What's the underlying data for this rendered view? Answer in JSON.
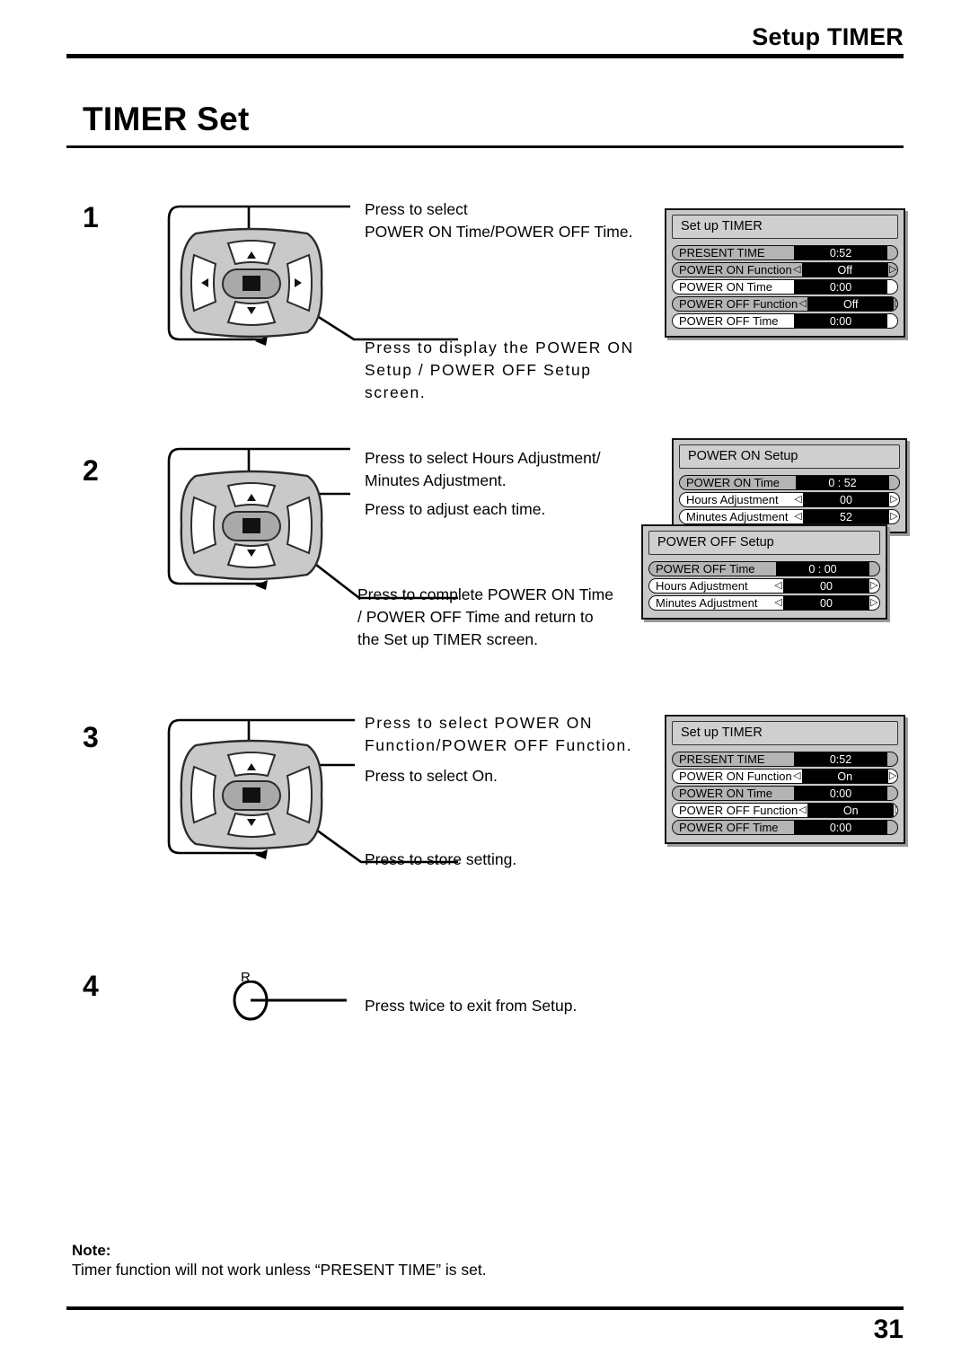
{
  "header": {
    "section_title": "Setup TIMER",
    "page_title": "TIMER Set",
    "page_number": "31"
  },
  "steps": [
    {
      "number": "1",
      "callouts": [
        "Press to select\nPOWER ON Time/POWER OFF Time.",
        "Press to display the POWER ON\nSetup / POWER OFF Setup\nscreen."
      ]
    },
    {
      "number": "2",
      "callouts": [
        "Press to select Hours Adjustment/\nMinutes Adjustment.",
        "Press to adjust each time.",
        "Press to complete POWER ON Time\n/ POWER OFF Time and return to\nthe Set up TIMER screen."
      ]
    },
    {
      "number": "3",
      "callouts": [
        "Press to select POWER ON\nFunction/POWER OFF Function.",
        "Press to select On.",
        "Press to store setting."
      ]
    },
    {
      "number": "4",
      "button_label": "R",
      "callouts": [
        "Press twice to exit from Setup."
      ]
    }
  ],
  "osd_panels": [
    {
      "id": "timer-1",
      "title": "Set up TIMER",
      "rows": [
        {
          "label": "PRESENT TIME",
          "value": "0:52",
          "fill": "grey",
          "arrows": false
        },
        {
          "label": "POWER ON Function",
          "value": "Off",
          "fill": "grey",
          "arrows": true
        },
        {
          "label": "POWER ON Time",
          "value": "0:00",
          "fill": "white",
          "arrows": false
        },
        {
          "label": "POWER OFF Function",
          "value": "Off",
          "fill": "grey",
          "arrows": true
        },
        {
          "label": "POWER OFF Time",
          "value": "0:00",
          "fill": "white",
          "arrows": false
        }
      ]
    },
    {
      "id": "power-on",
      "title": "POWER ON Setup",
      "rows": [
        {
          "label": "POWER ON Time",
          "value": "0 : 52",
          "fill": "grey",
          "arrows": false
        },
        {
          "label": "Hours Adjustment",
          "value": "00",
          "fill": "white",
          "arrows": true
        },
        {
          "label": "Minutes Adjustment",
          "value": "52",
          "fill": "white",
          "arrows": true
        }
      ]
    },
    {
      "id": "power-off",
      "title": "POWER OFF Setup",
      "rows": [
        {
          "label": "POWER OFF Time",
          "value": "0 : 00",
          "fill": "grey",
          "arrows": false
        },
        {
          "label": "Hours Adjustment",
          "value": "00",
          "fill": "white",
          "arrows": true
        },
        {
          "label": "Minutes Adjustment",
          "value": "00",
          "fill": "white",
          "arrows": true
        }
      ]
    },
    {
      "id": "timer-2",
      "title": "Set up TIMER",
      "rows": [
        {
          "label": "PRESENT TIME",
          "value": "0:52",
          "fill": "grey",
          "arrows": false
        },
        {
          "label": "POWER ON Function",
          "value": "On",
          "fill": "white",
          "arrows": true
        },
        {
          "label": "POWER ON Time",
          "value": "0:00",
          "fill": "grey",
          "arrows": false
        },
        {
          "label": "POWER OFF Function",
          "value": "On",
          "fill": "white",
          "arrows": true
        },
        {
          "label": "POWER OFF Time",
          "value": "0:00",
          "fill": "grey",
          "arrows": false
        }
      ]
    }
  ],
  "footer": {
    "note_title": "Note:",
    "note_body": "Timer function will not work unless “PRESENT TIME” is set."
  },
  "icons": {
    "arrow_left": "◁",
    "arrow_right": "▷"
  }
}
